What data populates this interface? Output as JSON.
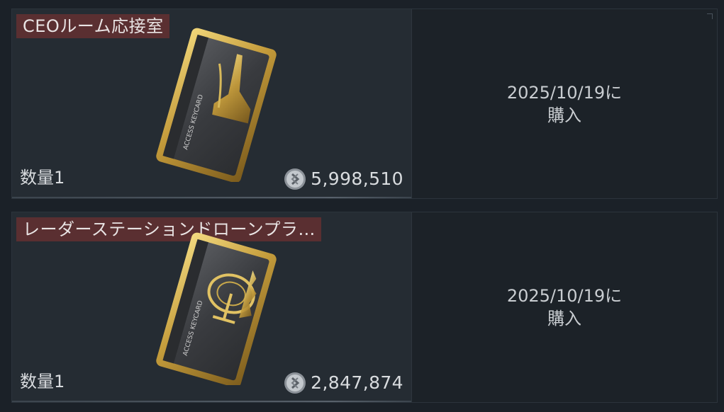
{
  "items": [
    {
      "title": "CEOルーム応接室",
      "quantity_label": "数量1",
      "price": "5,998,510",
      "purchase_date": "2025/10/19に",
      "purchase_word": "購入",
      "card_emblem": "spire-emblem",
      "card_text": "ACCESS KEYCARD"
    },
    {
      "title": "レーダーステーションドローンプラ…",
      "quantity_label": "数量1",
      "price": "2,847,874",
      "purchase_date": "2025/10/19に",
      "purchase_word": "購入",
      "card_emblem": "radar-dish-emblem",
      "card_text": "ACCESS KEYCARD"
    }
  ],
  "icons": {
    "currency": "silver-coin-icon"
  },
  "colors": {
    "title_badge": "#5a2f31",
    "card_gold": "#c9a84a",
    "card_face": "#3b3d40"
  }
}
